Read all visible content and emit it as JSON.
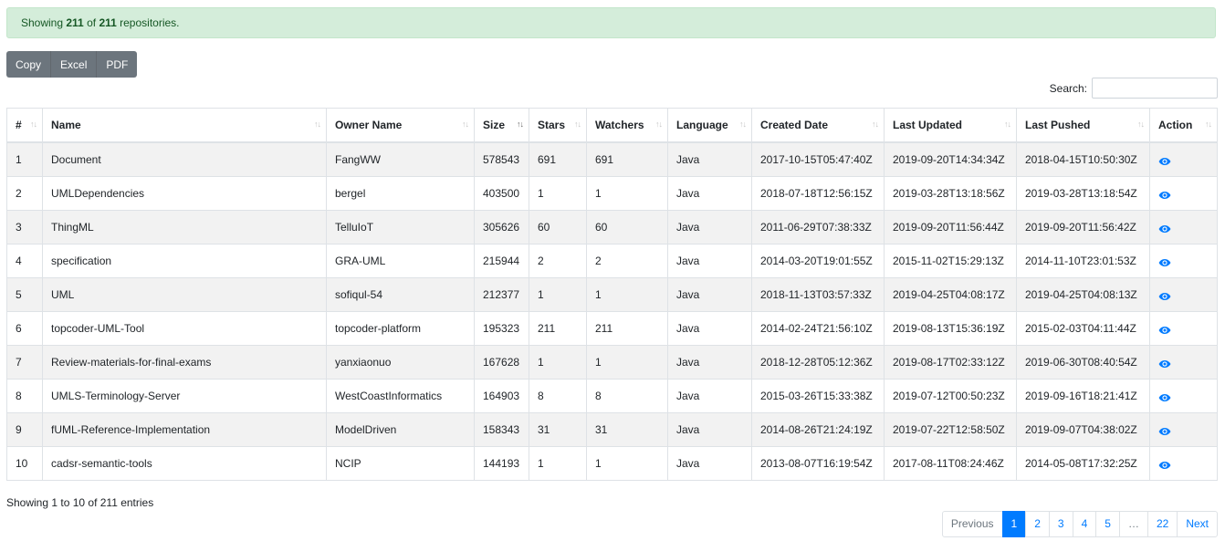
{
  "alert": {
    "prefix": "Showing",
    "shown": "211",
    "of": "of",
    "total": "211",
    "suffix": "repositories."
  },
  "buttons": {
    "copy": "Copy",
    "excel": "Excel",
    "pdf": "PDF"
  },
  "search": {
    "label": "Search:",
    "value": ""
  },
  "table": {
    "headers": [
      "#",
      "Name",
      "Owner Name",
      "Size",
      "Stars",
      "Watchers",
      "Language",
      "Created Date",
      "Last Updated",
      "Last Pushed",
      "Action"
    ],
    "rows": [
      [
        "1",
        "Document",
        "FangWW",
        "578543",
        "691",
        "691",
        "Java",
        "2017-10-15T05:47:40Z",
        "2019-09-20T14:34:34Z",
        "2018-04-15T10:50:30Z"
      ],
      [
        "2",
        "UMLDependencies",
        "bergel",
        "403500",
        "1",
        "1",
        "Java",
        "2018-07-18T12:56:15Z",
        "2019-03-28T13:18:56Z",
        "2019-03-28T13:18:54Z"
      ],
      [
        "3",
        "ThingML",
        "TelluIoT",
        "305626",
        "60",
        "60",
        "Java",
        "2011-06-29T07:38:33Z",
        "2019-09-20T11:56:44Z",
        "2019-09-20T11:56:42Z"
      ],
      [
        "4",
        "specification",
        "GRA-UML",
        "215944",
        "2",
        "2",
        "Java",
        "2014-03-20T19:01:55Z",
        "2015-11-02T15:29:13Z",
        "2014-11-10T23:01:53Z"
      ],
      [
        "5",
        "UML",
        "sofiqul-54",
        "212377",
        "1",
        "1",
        "Java",
        "2018-11-13T03:57:33Z",
        "2019-04-25T04:08:17Z",
        "2019-04-25T04:08:13Z"
      ],
      [
        "6",
        "topcoder-UML-Tool",
        "topcoder-platform",
        "195323",
        "211",
        "211",
        "Java",
        "2014-02-24T21:56:10Z",
        "2019-08-13T15:36:19Z",
        "2015-02-03T04:11:44Z"
      ],
      [
        "7",
        "Review-materials-for-final-exams",
        "yanxiaonuo",
        "167628",
        "1",
        "1",
        "Java",
        "2018-12-28T05:12:36Z",
        "2019-08-17T02:33:12Z",
        "2019-06-30T08:40:54Z"
      ],
      [
        "8",
        "UMLS-Terminology-Server",
        "WestCoastInformatics",
        "164903",
        "8",
        "8",
        "Java",
        "2015-03-26T15:33:38Z",
        "2019-07-12T00:50:23Z",
        "2019-09-16T18:21:41Z"
      ],
      [
        "9",
        "fUML-Reference-Implementation",
        "ModelDriven",
        "158343",
        "31",
        "31",
        "Java",
        "2014-08-26T21:24:19Z",
        "2019-07-22T12:58:50Z",
        "2019-09-07T04:38:02Z"
      ],
      [
        "10",
        "cadsr-semantic-tools",
        "NCIP",
        "144193",
        "1",
        "1",
        "Java",
        "2013-08-07T16:19:54Z",
        "2017-08-11T08:24:46Z",
        "2014-05-08T17:32:25Z"
      ]
    ]
  },
  "info": "Showing 1 to 10 of 211 entries",
  "pagination": {
    "previous": "Previous",
    "pages": [
      "1",
      "2",
      "3",
      "4",
      "5",
      "…",
      "22"
    ],
    "active_page": "1",
    "next": "Next"
  },
  "colors": {
    "primary": "#007bff",
    "alert_bg": "#d4edda",
    "alert_text": "#155724",
    "button_bg": "#6c757d"
  }
}
